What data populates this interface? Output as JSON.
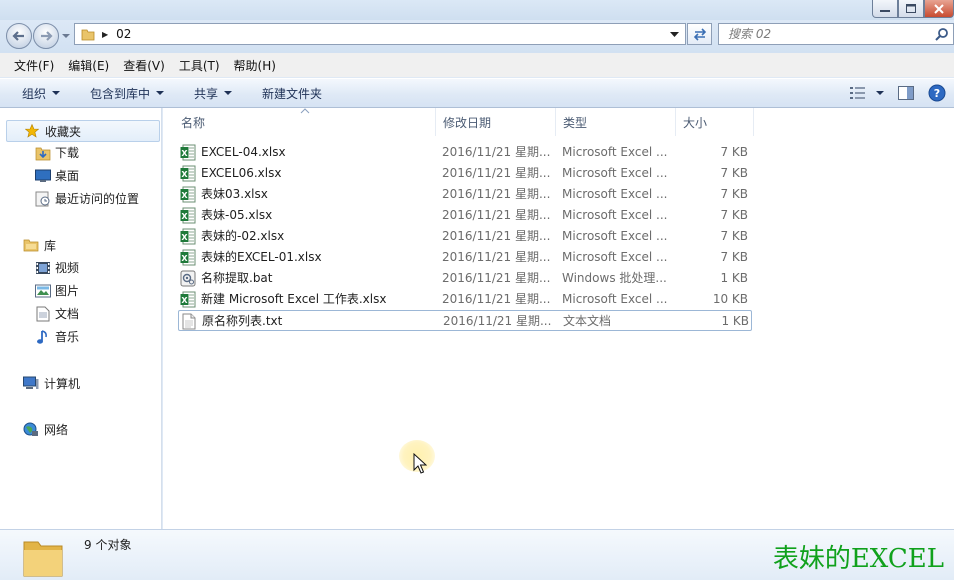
{
  "window": {
    "buttons": [
      "minimize",
      "maximize",
      "close"
    ]
  },
  "address": {
    "path_segments": [
      "02"
    ],
    "search_placeholder": "搜索 02"
  },
  "menu": [
    "文件(F)",
    "编辑(E)",
    "查看(V)",
    "工具(T)",
    "帮助(H)"
  ],
  "toolbar": {
    "organize": "组织",
    "include_in_library": "包含到库中",
    "share": "共享",
    "new_folder": "新建文件夹"
  },
  "nav": {
    "favorites": {
      "label": "收藏夹",
      "items": [
        "下载",
        "桌面",
        "最近访问的位置"
      ]
    },
    "libraries": {
      "label": "库",
      "items": [
        "视频",
        "图片",
        "文档",
        "音乐"
      ]
    },
    "computer": "计算机",
    "network": "网络"
  },
  "columns": [
    "名称",
    "修改日期",
    "类型",
    "大小"
  ],
  "files": [
    {
      "name": "EXCEL-04.xlsx",
      "date": "2016/11/21 星期...",
      "type": "Microsoft Excel ...",
      "size": "7 KB",
      "icon": "excel-icon"
    },
    {
      "name": "EXCEL06.xlsx",
      "date": "2016/11/21 星期...",
      "type": "Microsoft Excel ...",
      "size": "7 KB",
      "icon": "excel-icon"
    },
    {
      "name": "表妹03.xlsx",
      "date": "2016/11/21 星期...",
      "type": "Microsoft Excel ...",
      "size": "7 KB",
      "icon": "excel-icon"
    },
    {
      "name": "表妹-05.xlsx",
      "date": "2016/11/21 星期...",
      "type": "Microsoft Excel ...",
      "size": "7 KB",
      "icon": "excel-icon"
    },
    {
      "name": "表妹的-02.xlsx",
      "date": "2016/11/21 星期...",
      "type": "Microsoft Excel ...",
      "size": "7 KB",
      "icon": "excel-icon"
    },
    {
      "name": "表妹的EXCEL-01.xlsx",
      "date": "2016/11/21 星期...",
      "type": "Microsoft Excel ...",
      "size": "7 KB",
      "icon": "excel-icon"
    },
    {
      "name": "名称提取.bat",
      "date": "2016/11/21 星期...",
      "type": "Windows 批处理...",
      "size": "1 KB",
      "icon": "batch-file-icon"
    },
    {
      "name": "新建 Microsoft Excel 工作表.xlsx",
      "date": "2016/11/21 星期...",
      "type": "Microsoft Excel ...",
      "size": "10 KB",
      "icon": "excel-icon"
    },
    {
      "name": "原名称列表.txt",
      "date": "2016/11/21 星期...",
      "type": "文本文档",
      "size": "1 KB",
      "icon": "text-file-icon",
      "selected": true
    }
  ],
  "status": {
    "count": "9 个对象"
  },
  "watermark": "表妹的EXCEL",
  "colors": {
    "watermark": "#10a11c",
    "excel_green": "#1f7a3a",
    "accent": "#1e3156"
  }
}
